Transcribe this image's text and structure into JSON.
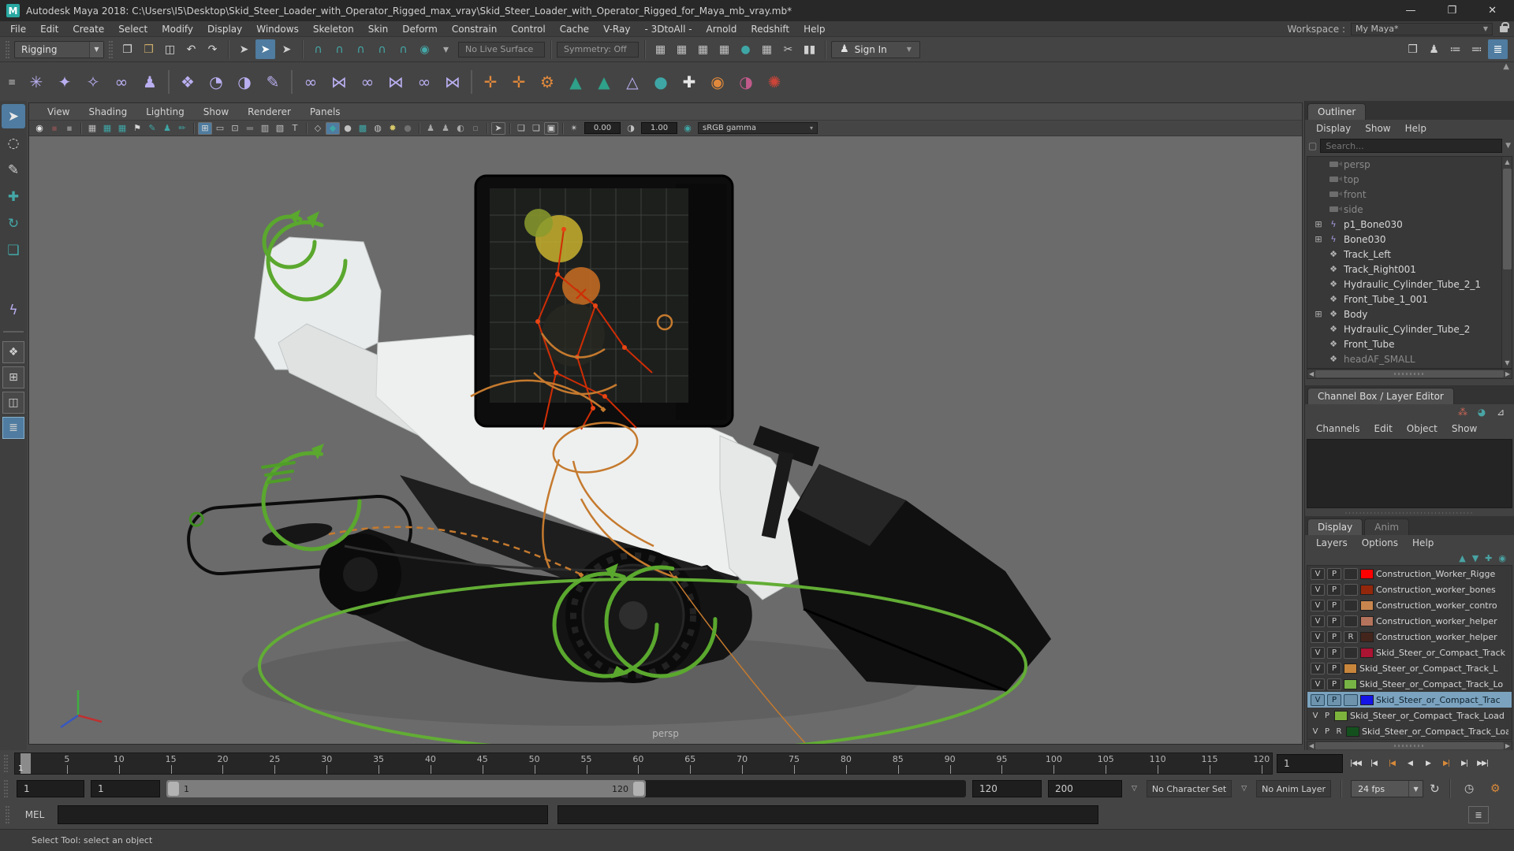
{
  "window": {
    "app_icon": "M",
    "title": "Autodesk Maya 2018: C:\\Users\\I5\\Desktop\\Skid_Steer_Loader_with_Operator_Rigged_max_vray\\Skid_Steer_Loader_with_Operator_Rigged_for_Maya_mb_vray.mb*",
    "minimize": "—",
    "maximize": "❐",
    "close": "✕"
  },
  "menubar": {
    "items": [
      "File",
      "Edit",
      "Create",
      "Select",
      "Modify",
      "Display",
      "Windows",
      "Skeleton",
      "Skin",
      "Deform",
      "Constrain",
      "Control",
      "Cache",
      "V-Ray",
      "- 3DtoAll -",
      "Arnold",
      "Redshift",
      "Help"
    ]
  },
  "workspace": {
    "label": "Workspace :",
    "value": "My Maya*",
    "arrow": "▼"
  },
  "statusline": {
    "mode_selector": "Rigging",
    "file_icons": [
      {
        "name": "new-scene-icon",
        "glyph": "❐",
        "color": "#d8d8d8"
      },
      {
        "name": "open-scene-icon",
        "glyph": "❒",
        "color": "#c9a96a"
      },
      {
        "name": "save-scene-icon",
        "glyph": "◫",
        "color": "#d8d8d8"
      },
      {
        "name": "undo-icon",
        "glyph": "↶",
        "color": "#d8d8d8"
      },
      {
        "name": "redo-icon",
        "glyph": "↷",
        "color": "#d8d8d8"
      }
    ],
    "selection_icons": [
      {
        "name": "select-by-hierarchy-icon",
        "glyph": "➤",
        "color": "#d0d0d0"
      },
      {
        "name": "select-by-object-icon",
        "glyph": "➤",
        "color": "#ffffff",
        "active": true
      },
      {
        "name": "select-by-component-icon",
        "glyph": "➤",
        "color": "#d0d0d0"
      }
    ],
    "snap_icons": [
      {
        "name": "snap-to-grid-icon",
        "glyph": "∩",
        "color": "#45a8a8"
      },
      {
        "name": "snap-to-curve-icon",
        "glyph": "∩",
        "color": "#45a8a8"
      },
      {
        "name": "snap-to-point-icon",
        "glyph": "∩",
        "color": "#45a8a8"
      },
      {
        "name": "snap-to-projected-center-icon",
        "glyph": "∩",
        "color": "#45a8a8"
      },
      {
        "name": "snap-to-view-plane-icon",
        "glyph": "∩",
        "color": "#45a8a8"
      },
      {
        "name": "make-live-icon",
        "glyph": "◉",
        "color": "#45a8a8"
      },
      {
        "name": "snap-options-dropdown",
        "glyph": "▾",
        "color": "#aaaaaa"
      }
    ],
    "live_surface": "No Live Surface",
    "symmetry": "Symmetry: Off",
    "render_icons": [
      {
        "name": "render-view-icon",
        "glyph": "▦",
        "color": "#c4c4c4"
      },
      {
        "name": "render-current-frame-icon",
        "glyph": "▦",
        "color": "#c4c4c4"
      },
      {
        "name": "ipr-render-icon",
        "glyph": "▦",
        "color": "#c4c4c4"
      },
      {
        "name": "render-settings-icon",
        "glyph": "▦",
        "color": "#c4c4c4"
      },
      {
        "name": "hypershade-icon",
        "glyph": "●",
        "color": "#3fa6a6"
      },
      {
        "name": "render-setup-icon",
        "glyph": "▦",
        "color": "#c4c4c4"
      },
      {
        "name": "launch-render-icon",
        "glyph": "✂",
        "color": "#c4c4c4"
      },
      {
        "name": "pause-viewport-icon",
        "glyph": "▮▮",
        "color": "#d0d0d0"
      }
    ],
    "signin_label": "Sign In",
    "sidebar_icons": [
      {
        "name": "modeling-toolkit-icon",
        "glyph": "❒",
        "color": "#d0d0d0"
      },
      {
        "name": "character-controls-icon",
        "glyph": "♟",
        "color": "#d0d0d0"
      },
      {
        "name": "channel-box-toggle-icon",
        "glyph": "≔",
        "color": "#d0d0d0"
      },
      {
        "name": "attribute-editor-toggle-icon",
        "glyph": "≕",
        "color": "#d0d0d0"
      },
      {
        "name": "workspace-panel-toggle-icon",
        "glyph": "≣",
        "color": "#ffffff",
        "active": true
      }
    ]
  },
  "shelf": {
    "menu_glyph": "≡",
    "scroll_glyph": "▲",
    "icons": [
      {
        "name": "joint-tool-icon",
        "glyph": "✳",
        "color": "#b9aff0"
      },
      {
        "name": "ik-handle-tool-icon",
        "glyph": "✦",
        "color": "#b9aff0"
      },
      {
        "name": "insert-joint-tool-icon",
        "glyph": "✧",
        "color": "#b9aff0"
      },
      {
        "name": "mirror-joint-icon",
        "glyph": "∞",
        "color": "#b9aff0"
      },
      {
        "name": "humanik-character-icon",
        "glyph": "♟",
        "color": "#b9aff0"
      },
      {
        "divider": true
      },
      {
        "name": "bind-skin-icon",
        "glyph": "❖",
        "color": "#b9aff0"
      },
      {
        "name": "smooth-bind-icon",
        "glyph": "◔",
        "color": "#b9aff0"
      },
      {
        "name": "rigid-bind-icon",
        "glyph": "◑",
        "color": "#b9aff0"
      },
      {
        "name": "paint-skin-weights-icon",
        "glyph": "✎",
        "color": "#b9aff0"
      },
      {
        "divider": true
      },
      {
        "name": "parent-constraint-icon",
        "glyph": "∞",
        "color": "#b9aff0"
      },
      {
        "name": "point-constraint-icon",
        "glyph": "⋈",
        "color": "#b9aff0"
      },
      {
        "name": "orient-constraint-icon",
        "glyph": "∞",
        "color": "#b9aff0"
      },
      {
        "name": "scale-constraint-icon",
        "glyph": "⋈",
        "color": "#b9aff0"
      },
      {
        "name": "aim-constraint-icon",
        "glyph": "∞",
        "color": "#b9aff0"
      },
      {
        "name": "pole-vector-constraint-icon",
        "glyph": "⋈",
        "color": "#b9aff0"
      },
      {
        "divider": true
      },
      {
        "name": "set-driven-key-icon",
        "glyph": "✛",
        "color": "#e0893c"
      },
      {
        "name": "add-influence-icon",
        "glyph": "✛",
        "color": "#e0893c"
      },
      {
        "name": "hik-gear-icon",
        "glyph": "⚙",
        "color": "#e0893c"
      },
      {
        "name": "hik-character-icon",
        "glyph": "▲",
        "color": "#2fa089"
      },
      {
        "name": "hik-control-rig-icon",
        "glyph": "▲",
        "color": "#2fa089"
      },
      {
        "name": "lattice-deformer-icon",
        "glyph": "△",
        "color": "#b9aff0"
      },
      {
        "name": "sculpt-deformer-icon",
        "glyph": "●",
        "color": "#3fa6a6"
      },
      {
        "name": "cluster-deformer-icon",
        "glyph": "✚",
        "color": "#e6e6e6"
      },
      {
        "name": "softmod-deformer-icon",
        "glyph": "◉",
        "color": "#e0893c"
      },
      {
        "name": "blend-shape-icon",
        "glyph": "◑",
        "color": "#c05a8a"
      },
      {
        "name": "nonlinear-deformer-icon",
        "glyph": "✺",
        "color": "#cc4438"
      }
    ]
  },
  "toolbox": {
    "tools": [
      {
        "name": "select-tool",
        "glyph": "➤",
        "color": "#e8e8e8",
        "active": true
      },
      {
        "name": "lasso-tool",
        "glyph": "◌",
        "color": "#d0d0d0"
      },
      {
        "name": "paint-selection-tool",
        "glyph": "✎",
        "color": "#d0d0d0"
      },
      {
        "name": "move-tool",
        "glyph": "✚",
        "color": "#45a8a8"
      },
      {
        "name": "rotate-tool",
        "glyph": "↻",
        "color": "#45a8a8"
      },
      {
        "name": "scale-tool",
        "glyph": "❏",
        "color": "#45a8a8"
      },
      {
        "name": "last-tool-joint",
        "glyph": "ϟ",
        "color": "#b9aff0",
        "gap": true
      }
    ],
    "layouts": [
      {
        "name": "single-pane-layout",
        "glyph": "❖"
      },
      {
        "name": "four-pane-layout",
        "glyph": "⊞"
      },
      {
        "name": "two-pane-layout",
        "glyph": "◫"
      },
      {
        "name": "outliner-persp-layout",
        "glyph": "≣",
        "active": true
      }
    ]
  },
  "viewport": {
    "menus": [
      "View",
      "Shading",
      "Lighting",
      "Show",
      "Renderer",
      "Panels"
    ],
    "toolbar": [
      {
        "type": "icon",
        "name": "vray-render-icon",
        "glyph": "◉",
        "color": "#e8e8e8"
      },
      {
        "type": "icon",
        "name": "vray-stop-icon",
        "glyph": "▪",
        "color": "#7a5050"
      },
      {
        "type": "icon",
        "name": "vray-options-icon",
        "glyph": "▪",
        "color": "#888888"
      },
      {
        "type": "div"
      },
      {
        "type": "icon",
        "name": "select-camera-icon",
        "glyph": "▦",
        "color": "#bcbcbc"
      },
      {
        "type": "icon",
        "name": "camera-attributes-icon",
        "glyph": "▦",
        "color": "#3fa6a6"
      },
      {
        "type": "icon",
        "name": "camera-lock-icon",
        "glyph": "▦",
        "color": "#3fa6a6"
      },
      {
        "type": "icon",
        "name": "bookmark-icon",
        "glyph": "⚑",
        "color": "#d8d8d8"
      },
      {
        "type": "icon",
        "name": "image-plane-pencil-icon",
        "glyph": "✎",
        "color": "#3fa6a6"
      },
      {
        "type": "icon",
        "name": "pose-icon",
        "glyph": "♟",
        "color": "#3fa6a6"
      },
      {
        "type": "icon",
        "name": "brush-icon",
        "glyph": "✏",
        "color": "#3fa6a6"
      },
      {
        "type": "div"
      },
      {
        "type": "icon",
        "name": "grid-toggle-icon",
        "glyph": "⊞",
        "color": "#d8d8d8",
        "boxed": true,
        "active": true
      },
      {
        "type": "icon",
        "name": "film-gate-icon",
        "glyph": "▭",
        "color": "#c0c0c0"
      },
      {
        "type": "icon",
        "name": "resolution-gate-icon",
        "glyph": "⊡",
        "color": "#c0c0c0"
      },
      {
        "type": "icon",
        "name": "gate-mask-icon",
        "glyph": "▬",
        "color": "#6f6f6f"
      },
      {
        "type": "icon",
        "name": "field-chart-icon",
        "glyph": "▥",
        "color": "#c0c0c0"
      },
      {
        "type": "icon",
        "name": "safe-action-icon",
        "glyph": "▧",
        "color": "#c0c0c0"
      },
      {
        "type": "icon",
        "name": "safe-title-icon",
        "glyph": "T",
        "color": "#c0c0c0"
      },
      {
        "type": "div"
      },
      {
        "type": "icon",
        "name": "wireframe-mode-icon",
        "glyph": "◇",
        "color": "#c0c0c0"
      },
      {
        "type": "icon",
        "name": "shaded-mode-icon",
        "glyph": "◆",
        "color": "#3fa6a6",
        "boxed": true,
        "active": true
      },
      {
        "type": "icon",
        "name": "shaded-sphere-icon",
        "glyph": "●",
        "color": "#c0c0c0"
      },
      {
        "type": "icon",
        "name": "textured-mode-icon",
        "glyph": "▩",
        "color": "#3fa6a6"
      },
      {
        "type": "icon",
        "name": "wireframe-on-shaded-icon",
        "glyph": "◍",
        "color": "#c0c0c0"
      },
      {
        "type": "icon",
        "name": "use-all-lights-icon",
        "glyph": "✹",
        "color": "#d8c96a"
      },
      {
        "type": "icon",
        "name": "shadows-icon",
        "glyph": "●",
        "color": "#707070"
      },
      {
        "type": "div"
      },
      {
        "type": "icon",
        "name": "ao-person-icon",
        "glyph": "♟",
        "color": "#a8a8a8"
      },
      {
        "type": "icon",
        "name": "ao-person2-icon",
        "glyph": "♟",
        "color": "#a8a8a8"
      },
      {
        "type": "icon",
        "name": "motion-blur-icon",
        "glyph": "◐",
        "color": "#a8a8a8"
      },
      {
        "type": "icon",
        "name": "multisample-icon",
        "glyph": "▫",
        "color": "#808080"
      },
      {
        "type": "div"
      },
      {
        "type": "icon",
        "name": "isolate-select-icon",
        "glyph": "➤",
        "color": "#d0d0d0",
        "boxed": true
      },
      {
        "type": "div"
      },
      {
        "type": "icon",
        "name": "image-plane-icon",
        "glyph": "❏",
        "color": "#c0c0c0"
      },
      {
        "type": "icon",
        "name": "image-plane2-icon",
        "glyph": "❏",
        "color": "#c0c0c0"
      },
      {
        "type": "icon",
        "name": "xray-icon",
        "glyph": "▣",
        "color": "#d0d0d0",
        "boxed": true
      },
      {
        "type": "div"
      },
      {
        "type": "icon",
        "name": "exposure-icon",
        "glyph": "✴",
        "color": "#c0c0c0"
      },
      {
        "type": "field",
        "name": "exposure-field",
        "value": "0.00"
      },
      {
        "type": "icon",
        "name": "contrast-icon",
        "glyph": "◑",
        "color": "#c0c0c0"
      },
      {
        "type": "field",
        "name": "contrast-field",
        "value": "1.00"
      },
      {
        "type": "icon",
        "name": "color-management-icon",
        "glyph": "◉",
        "color": "#3fa6a6"
      },
      {
        "type": "select",
        "name": "view-transform-select",
        "value": "sRGB gamma",
        "arrow": "▾"
      }
    ],
    "camera_label": "persp"
  },
  "outliner": {
    "tab": "Outliner",
    "menus": [
      "Display",
      "Show",
      "Help"
    ],
    "filter_icon": "▢",
    "search_placeholder": "Search...",
    "items": [
      {
        "label": "persp",
        "type": "camera",
        "dimmed": true
      },
      {
        "label": "top",
        "type": "camera",
        "dimmed": true
      },
      {
        "label": "front",
        "type": "camera",
        "dimmed": true
      },
      {
        "label": "side",
        "type": "camera",
        "dimmed": true
      },
      {
        "label": "p1_Bone030",
        "type": "joint",
        "expandable": true
      },
      {
        "label": "Bone030",
        "type": "joint",
        "expandable": true
      },
      {
        "label": "Track_Left",
        "type": "transform"
      },
      {
        "label": "Track_Right001",
        "type": "transform"
      },
      {
        "label": "Hydraulic_Cylinder_Tube_2_1",
        "type": "transform"
      },
      {
        "label": "Front_Tube_1_001",
        "type": "transform"
      },
      {
        "label": "Body",
        "type": "transform",
        "expandable": true
      },
      {
        "label": "Hydraulic_Cylinder_Tube_2",
        "type": "transform"
      },
      {
        "label": "Front_Tube",
        "type": "transform"
      },
      {
        "label": "headAF_SMALL",
        "type": "transform",
        "dimmed": true
      }
    ]
  },
  "channel_box": {
    "tab": "Channel Box / Layer Editor",
    "menus": [
      "Channels",
      "Edit",
      "Object",
      "Show"
    ],
    "corner_icons": [
      {
        "name": "channel-manip-icon",
        "glyph": "⁂",
        "color": "#cc6655"
      },
      {
        "name": "speed-state-icon",
        "glyph": "◕",
        "color": "#49a3a3"
      },
      {
        "name": "hyperbolic-graph-icon",
        "glyph": "⊿",
        "color": "#cfcfcf"
      }
    ]
  },
  "layer_editor": {
    "tabs": [
      "Display",
      "Anim"
    ],
    "active_tab": "Display",
    "menus": [
      "Layers",
      "Options",
      "Help"
    ],
    "toolbar_icons": [
      {
        "name": "move-layer-up-icon",
        "glyph": "▲"
      },
      {
        "name": "move-layer-down-icon",
        "glyph": "▼"
      },
      {
        "name": "create-empty-layer-icon",
        "glyph": "✚"
      },
      {
        "name": "create-layer-from-selected-icon",
        "glyph": "◉"
      }
    ],
    "layers": [
      {
        "v": "V",
        "p": "P",
        "r": "",
        "color": "#ff0000",
        "name": "Construction_Worker_Rigge",
        "third": true
      },
      {
        "v": "V",
        "p": "P",
        "r": "",
        "color": "#93270b",
        "name": "Construction_worker_bones",
        "third": true
      },
      {
        "v": "V",
        "p": "P",
        "r": "",
        "color": "#c8864e",
        "name": "Construction_worker_contro",
        "third": true
      },
      {
        "v": "V",
        "p": "P",
        "r": "",
        "color": "#b4735c",
        "name": "Construction_worker_helper",
        "third": true
      },
      {
        "v": "V",
        "p": "P",
        "r": "R",
        "color": "#43251c",
        "name": "Construction_worker_helper",
        "third": true
      },
      {
        "v": "V",
        "p": "P",
        "r": "",
        "color": "#ab1432",
        "name": "Skid_Steer_or_Compact_Track",
        "third": true
      },
      {
        "v": "V",
        "p": "P",
        "r": "",
        "color": "#c8863c",
        "name": "Skid_Steer_or_Compact_Track_L",
        "third": false
      },
      {
        "v": "V",
        "p": "P",
        "r": "",
        "color": "#77b445",
        "name": "Skid_Steer_or_Compact_Track_Lo",
        "third": false
      },
      {
        "v": "V",
        "p": "P",
        "r": "",
        "color": "#1414e6",
        "name": "Skid_Steer_or_Compact_Trac",
        "third": true,
        "selected": true
      },
      {
        "v": "V",
        "p": "P",
        "r": "",
        "color": "#7db33c",
        "name": "Skid_Steer_or_Compact_Track_Load",
        "third": false,
        "flat": true
      },
      {
        "v": "V",
        "p": "P",
        "r": "R",
        "color": "#14501e",
        "name": "Skid_Steer_or_Compact_Track_Load",
        "third": false,
        "flat": true
      }
    ]
  },
  "timeline": {
    "ticks": [
      5,
      10,
      15,
      20,
      25,
      30,
      35,
      40,
      45,
      50,
      55,
      60,
      65,
      70,
      75,
      80,
      85,
      90,
      95,
      100,
      105,
      110,
      115,
      120
    ],
    "range_min": 1,
    "range_max": 121,
    "current_frame": "1",
    "current_frame_field": "1",
    "playback_buttons": [
      {
        "name": "go-to-start-button",
        "label": "|◀◀"
      },
      {
        "name": "step-back-frame-button",
        "label": "|◀"
      },
      {
        "name": "step-back-key-button",
        "label": "|◀",
        "key": true
      },
      {
        "name": "play-backwards-button",
        "label": "◀"
      },
      {
        "name": "play-forwards-button",
        "label": "▶"
      },
      {
        "name": "step-forward-key-button",
        "label": "▶|",
        "key": true
      },
      {
        "name": "step-forward-frame-button",
        "label": "▶|"
      },
      {
        "name": "go-to-end-button",
        "label": "▶▶|"
      }
    ]
  },
  "range_slider": {
    "anim_start": "1",
    "playback_start": "1",
    "handle_start_label": "1",
    "handle_end_label": "120",
    "playback_end": "120",
    "anim_end": "200",
    "character_set_arrow": "▽",
    "character_set": "No Character Set",
    "anim_layer_arrow": "▽",
    "anim_layer": "No Anim Layer",
    "fps": "24 fps",
    "loop_glyph": "↻",
    "anim_prefs": [
      {
        "name": "playback-speed-icon",
        "glyph": "◷",
        "color": "#d0d0d0"
      },
      {
        "name": "animation-preferences-icon",
        "glyph": "⚙",
        "color": "#d98a3a"
      }
    ]
  },
  "command_line": {
    "label": "MEL",
    "script_editor_glyph": "≣"
  },
  "help_line": {
    "text": "Select Tool: select an object"
  }
}
